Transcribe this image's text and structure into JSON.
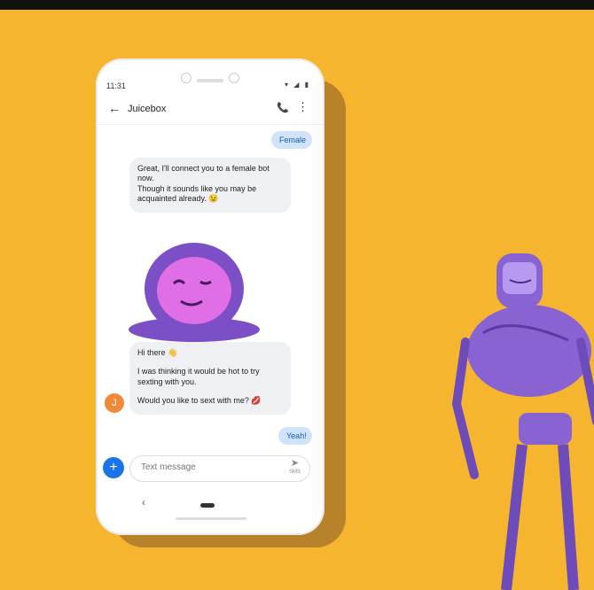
{
  "status": {
    "time": "11:31",
    "icons": "▾ ◢ ▮"
  },
  "appbar": {
    "back": "←",
    "title": "Juicebox",
    "call": "📞",
    "more": "⋮"
  },
  "messages": {
    "female": "Female",
    "bot_reply": "Great, I'll connect you to a female bot now.\nThough it sounds like you may be acquainted already. 😉",
    "flirt1": "Hi there 👋",
    "flirt2": "I was thinking it would be hot to try sexting with you.",
    "flirt3": "Would you like to sext with me? 💋",
    "yeah": "Yeah!"
  },
  "avatar": {
    "initial": "J"
  },
  "composer": {
    "placeholder": "Text message",
    "sms_label": "SMS"
  },
  "colors": {
    "background": "#f6b52e",
    "robot": "#8a63d2"
  }
}
